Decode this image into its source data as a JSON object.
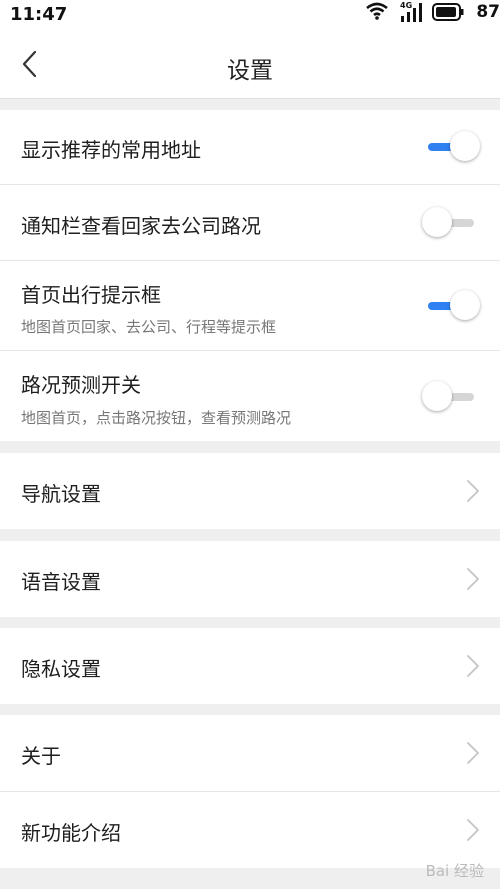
{
  "status_bar": {
    "time": "11:47",
    "network_label": "4G",
    "battery_level": "87",
    "icons": [
      "wifi-icon",
      "signal-icon",
      "battery-icon"
    ]
  },
  "header": {
    "title": "设置",
    "back_icon": "chevron-left-icon"
  },
  "toggles": [
    {
      "label": "显示推荐的常用地址",
      "subtitle": "",
      "on": true
    },
    {
      "label": "通知栏查看回家去公司路况",
      "subtitle": "",
      "on": false
    },
    {
      "label": "首页出行提示框",
      "subtitle": "地图首页回家、去公司、行程等提示框",
      "on": true
    },
    {
      "label": "路况预测开关",
      "subtitle": "地图首页，点击路况按钮，查看预测路况",
      "on": false
    }
  ],
  "nav_items": [
    {
      "label": "导航设置"
    },
    {
      "label": "语音设置"
    },
    {
      "label": "隐私设置"
    },
    {
      "label": "关于"
    },
    {
      "label": "新功能介绍"
    }
  ],
  "watermark": "Bai 经验",
  "colors": {
    "accent": "#2f80f0",
    "background": "#efefef"
  }
}
